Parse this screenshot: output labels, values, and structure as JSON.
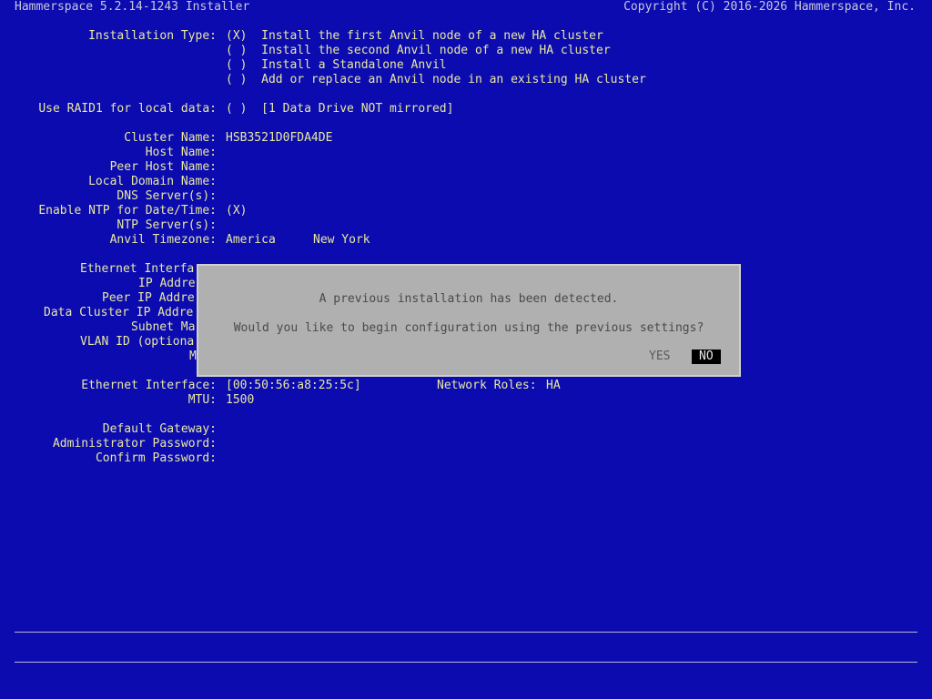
{
  "header": {
    "title": "Hammerspace 5.2.14-1243 Installer",
    "copyright": "Copyright (C) 2016-2026 Hammerspace, Inc."
  },
  "installation": {
    "label": "Installation Type:",
    "options": [
      {
        "mark": "(X)",
        "text": "Install the first Anvil node of a new HA cluster"
      },
      {
        "mark": "( )",
        "text": "Install the second Anvil node of a new HA cluster"
      },
      {
        "mark": "( )",
        "text": "Install a Standalone Anvil"
      },
      {
        "mark": "( )",
        "text": "Add or replace an Anvil node in an existing HA cluster"
      }
    ]
  },
  "raid": {
    "label": "Use RAID1 for local data:",
    "mark": "( )",
    "note": "[1 Data Drive NOT mirrored]"
  },
  "cluster": {
    "cluster_name_label": "Cluster Name:",
    "cluster_name_value": "HSB3521D0FDA4DE",
    "host_name_label": "Host Name:",
    "peer_host_name_label": "Peer Host Name:",
    "local_domain_label": "Local Domain Name:",
    "dns_label": "DNS Server(s):",
    "ntp_enable_label": "Enable NTP for Date/Time:",
    "ntp_enable_mark": "(X)",
    "ntp_servers_label": "NTP Server(s):",
    "timezone_label": "Anvil Timezone:",
    "timezone_region": "America",
    "timezone_city": "New York"
  },
  "iface1": {
    "eth_label": "Ethernet Interfa",
    "ip_label": "IP Addre",
    "peer_ip_label": "Peer IP Addre",
    "data_ip_label": "Data Cluster IP Addre",
    "subnet_label": "Subnet Ma",
    "vlan_label": "VLAN ID (optiona",
    "m_label": "M"
  },
  "iface2": {
    "eth_label": "Ethernet Interface:",
    "eth_value": "[00:50:56:a8:25:5c]",
    "roles_label": "Network Roles:",
    "roles_value": "HA",
    "mtu_label": "MTU:",
    "mtu_value": "1500"
  },
  "gateway": {
    "default_gw_label": "Default Gateway:",
    "admin_pw_label": "Administrator Password:",
    "confirm_pw_label": "Confirm Password:"
  },
  "dialog": {
    "message1": "A previous installation has been detected.",
    "message2": "Would you like to begin configuration using the previous settings?",
    "yes_label": "YES",
    "no_label": "NO"
  },
  "colors": {
    "background": "#0b0bb0",
    "text": "#e8e8a0",
    "dialog_bg": "#b0b0b0",
    "selected_button": "#000000"
  }
}
